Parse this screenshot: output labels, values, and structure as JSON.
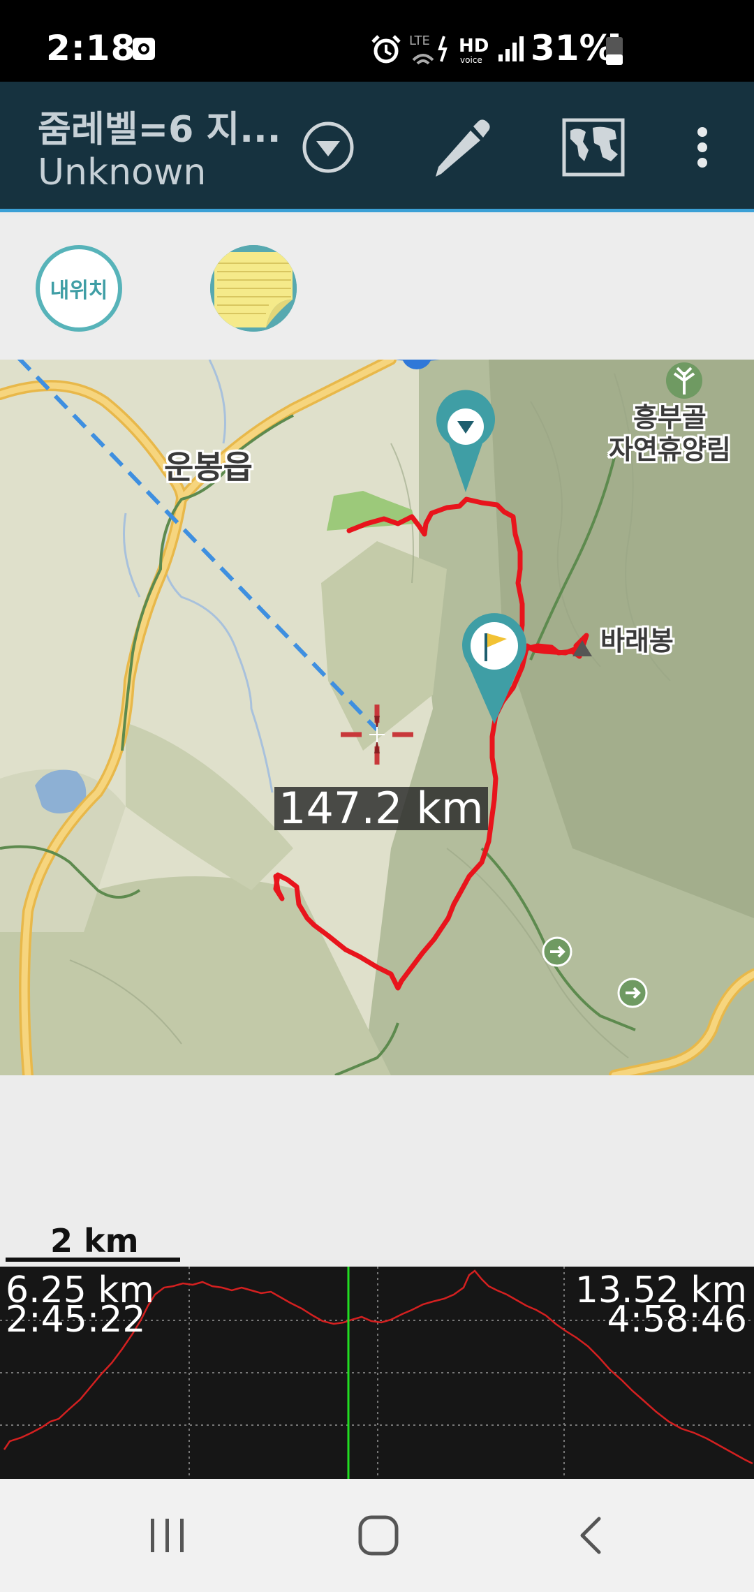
{
  "status_bar": {
    "time": "2:18",
    "battery_percent": "31%",
    "network": "LTE",
    "hd_voice": "HD",
    "icons": [
      "screenshot-icon",
      "alarm-icon",
      "lte-icon",
      "hd-voice-icon",
      "signal-icon",
      "battery-icon"
    ]
  },
  "app_bar": {
    "title": "줌레벨=6 지...",
    "subtitle": "Unknown",
    "icons": [
      "dropdown-icon",
      "pencil-icon",
      "world-map-icon",
      "more-vert-icon"
    ],
    "colors": {
      "background": "#16323f",
      "accent": "#3ba0d6"
    }
  },
  "tools": {
    "my_location_label": "내위치",
    "memo_icon": "memo-icon"
  },
  "map": {
    "labels": {
      "town": "운봉읍",
      "forest": "흥부골\n자연휴양림",
      "peak": "바래봉"
    },
    "distance_label": "147.2 km",
    "track_color": "#e8141c",
    "markers": [
      "waypoint-marker",
      "start-flag-marker",
      "crosshair-icon"
    ]
  },
  "scale": {
    "label": "2 km"
  },
  "profile": {
    "left_distance": "6.25 km",
    "left_time": "2:45:22",
    "right_distance": "13.52 km",
    "right_time": "4:58:46",
    "line_color": "#d42020",
    "cursor_color": "#22dd22"
  },
  "nav_bar": {
    "icons": [
      "recents-icon",
      "home-icon",
      "back-icon"
    ]
  }
}
